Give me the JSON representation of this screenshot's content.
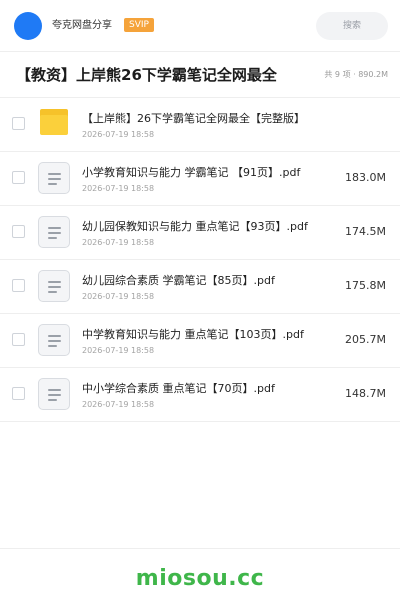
{
  "header": {
    "sharer_name": "夸克网盘分享",
    "badge": "SVIP",
    "search_placeholder": "搜索"
  },
  "folder": {
    "title": "【教资】上岸熊26下学霸笔记全网最全",
    "summary": "共 9 项 · 890.2M"
  },
  "files": [
    {
      "type": "folder",
      "name": "【上岸熊】26下学霸笔记全网最全【完整版】",
      "date": "2026-07-19 18:58",
      "size": ""
    },
    {
      "type": "file",
      "name": "小学教育知识与能力 学霸笔记 【91页】.pdf",
      "date": "2026-07-19 18:58",
      "size": "183.0M"
    },
    {
      "type": "file",
      "name": "幼儿园保教知识与能力 重点笔记【93页】.pdf",
      "date": "2026-07-19 18:58",
      "size": "174.5M"
    },
    {
      "type": "file",
      "name": "幼儿园综合素质 学霸笔记【85页】.pdf",
      "date": "2026-07-19 18:58",
      "size": "175.8M"
    },
    {
      "type": "file",
      "name": "中学教育知识与能力 重点笔记【103页】.pdf",
      "date": "2026-07-19 18:58",
      "size": "205.7M"
    },
    {
      "type": "file",
      "name": "中小学综合素质 重点笔记【70页】.pdf",
      "date": "2026-07-19 18:58",
      "size": "148.7M"
    }
  ],
  "footer": {
    "brand": "miosou.cc"
  },
  "colors": {
    "accent_blue": "#1f7af5",
    "badge_orange": "#f5a33a",
    "folder_yellow": "#fbd03b",
    "brand_green": "#3fb64a"
  }
}
